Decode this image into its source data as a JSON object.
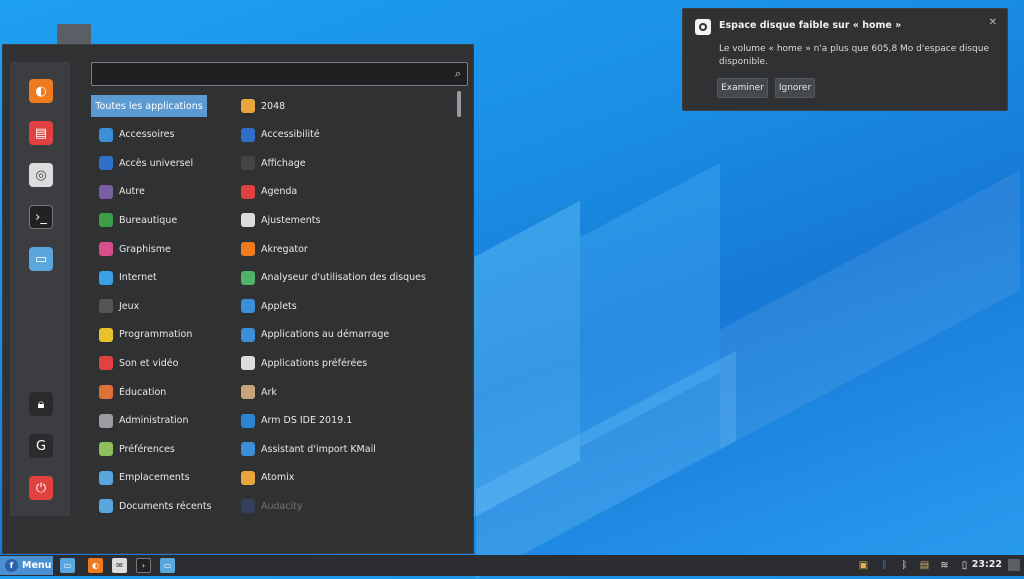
{
  "search": {
    "placeholder": "",
    "value": ""
  },
  "categories": [
    {
      "label": "Toutes les applications",
      "icon": "all-apps",
      "selected": true
    },
    {
      "label": "Accessoires",
      "icon": "accessories-icon",
      "color": "#3b8fd9"
    },
    {
      "label": "Accès universel",
      "icon": "accessibility-icon",
      "color": "#2f6fc9"
    },
    {
      "label": "Autre",
      "icon": "other-icon",
      "color": "#7a5fa3"
    },
    {
      "label": "Bureautique",
      "icon": "office-icon",
      "color": "#3f9d48"
    },
    {
      "label": "Graphisme",
      "icon": "graphics-icon",
      "color": "#d94d8c"
    },
    {
      "label": "Internet",
      "icon": "internet-icon",
      "color": "#3aa0e6"
    },
    {
      "label": "Jeux",
      "icon": "games-icon",
      "color": "#555"
    },
    {
      "label": "Programmation",
      "icon": "programming-icon",
      "color": "#e8c22d"
    },
    {
      "label": "Son et vidéo",
      "icon": "multimedia-icon",
      "color": "#e04141"
    },
    {
      "label": "Éducation",
      "icon": "education-icon",
      "color": "#e0703a"
    },
    {
      "label": "Administration",
      "icon": "administration-icon",
      "color": "#9a9ca0"
    },
    {
      "label": "Préférences",
      "icon": "preferences-icon",
      "color": "#8fbf5a"
    },
    {
      "label": "Emplacements",
      "icon": "folder-icon",
      "color": "#5aa7de"
    },
    {
      "label": "Documents récents",
      "icon": "recent-icon",
      "color": "#5aa7de"
    }
  ],
  "apps": [
    {
      "label": "2048",
      "icon": "2048-icon",
      "color": "#e8a53a"
    },
    {
      "label": "Accessibilité",
      "icon": "accessibility-icon",
      "color": "#2f6fc9"
    },
    {
      "label": "Affichage",
      "icon": "display-icon",
      "color": "#444"
    },
    {
      "label": "Agenda",
      "icon": "calendar-icon",
      "color": "#e04141"
    },
    {
      "label": "Ajustements",
      "icon": "tweaks-icon",
      "color": "#dcdcdc"
    },
    {
      "label": "Akregator",
      "icon": "rss-icon",
      "color": "#f07b1e"
    },
    {
      "label": "Analyseur d'utilisation des disques",
      "icon": "disk-usage-icon",
      "color": "#4fb36a"
    },
    {
      "label": "Applets",
      "icon": "applets-icon",
      "color": "#3b8fd9"
    },
    {
      "label": "Applications au démarrage",
      "icon": "startup-icon",
      "color": "#3b8fd9"
    },
    {
      "label": "Applications préférées",
      "icon": "preferred-apps-icon",
      "color": "#dcdcdc"
    },
    {
      "label": "Ark",
      "icon": "ark-icon",
      "color": "#c8a57a"
    },
    {
      "label": "Arm DS IDE 2019.1",
      "icon": "arm-ide-icon",
      "color": "#2a86d0"
    },
    {
      "label": "Assistant d'import KMail",
      "icon": "kmail-import-icon",
      "color": "#3b8fd9"
    },
    {
      "label": "Atomix",
      "icon": "atomix-icon",
      "color": "#e8a53a"
    },
    {
      "label": "Audacity",
      "icon": "audacity-icon",
      "color": "#3b5fa8"
    }
  ],
  "favorites": [
    {
      "name": "firefox-icon",
      "color": "#f07b1e"
    },
    {
      "name": "software-center-icon",
      "color": "#e04141"
    },
    {
      "name": "settings-icon",
      "color": "#dcdcdc"
    },
    {
      "name": "terminal-icon",
      "color": "#222"
    },
    {
      "name": "files-icon",
      "color": "#5aa7de"
    }
  ],
  "session": [
    {
      "name": "lock-icon"
    },
    {
      "name": "logout-icon"
    },
    {
      "name": "power-icon",
      "color": "#e04141"
    }
  ],
  "notification": {
    "title": "Espace disque faible sur « home »",
    "body": "Le volume « home » n'a plus que 605,8 Mo d'espace disque disponible.",
    "examine": "Examiner",
    "ignore": "Ignorer"
  },
  "taskbar": {
    "menu_label": "Menu",
    "clock": "23:22"
  }
}
